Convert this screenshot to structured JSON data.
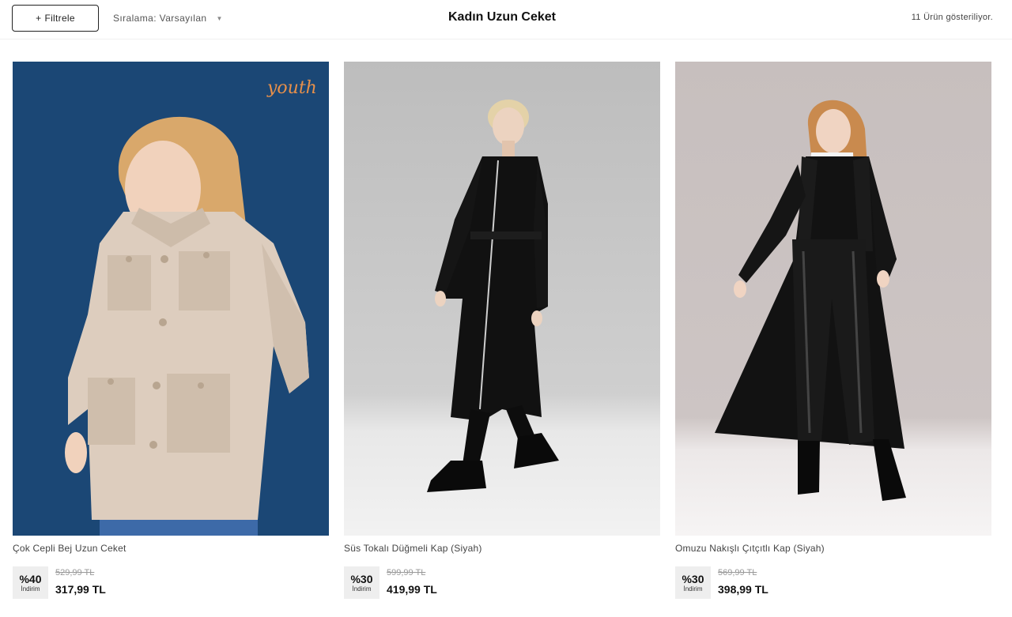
{
  "toolbar": {
    "filter_label": "Filtrele",
    "sort_label": "Sıralama: Varsayılan",
    "title": "Kadın Uzun Ceket",
    "count_label": "11 Ürün gösteriliyor."
  },
  "products": [
    {
      "name": "Çok Cepli Bej Uzun Ceket",
      "discount": "%40",
      "discount_label": "İndirim",
      "old_price": "529,99 TL",
      "price": "317,99 TL",
      "badge": "youth",
      "colors": {
        "background": "#1e4d7c",
        "garment": "#ddcdbe",
        "hair": "#d9a86b",
        "accent": "#e8904a"
      }
    },
    {
      "name": "Süs Tokalı Düğmeli Kap (Siyah)",
      "discount": "%30",
      "discount_label": "İndirim",
      "old_price": "599,99 TL",
      "price": "419,99 TL",
      "colors": {
        "background": "#c4c4c4",
        "garment": "#111111",
        "hair": "#e4d2a8"
      }
    },
    {
      "name": "Omuzu Nakışlı Çıtçıtlı Kap (Siyah)",
      "discount": "%30",
      "discount_label": "İndirim",
      "old_price": "569,99 TL",
      "price": "398,99 TL",
      "colors": {
        "background": "#c9c1c0",
        "garment": "#121212",
        "hair": "#c98a4e"
      }
    }
  ]
}
